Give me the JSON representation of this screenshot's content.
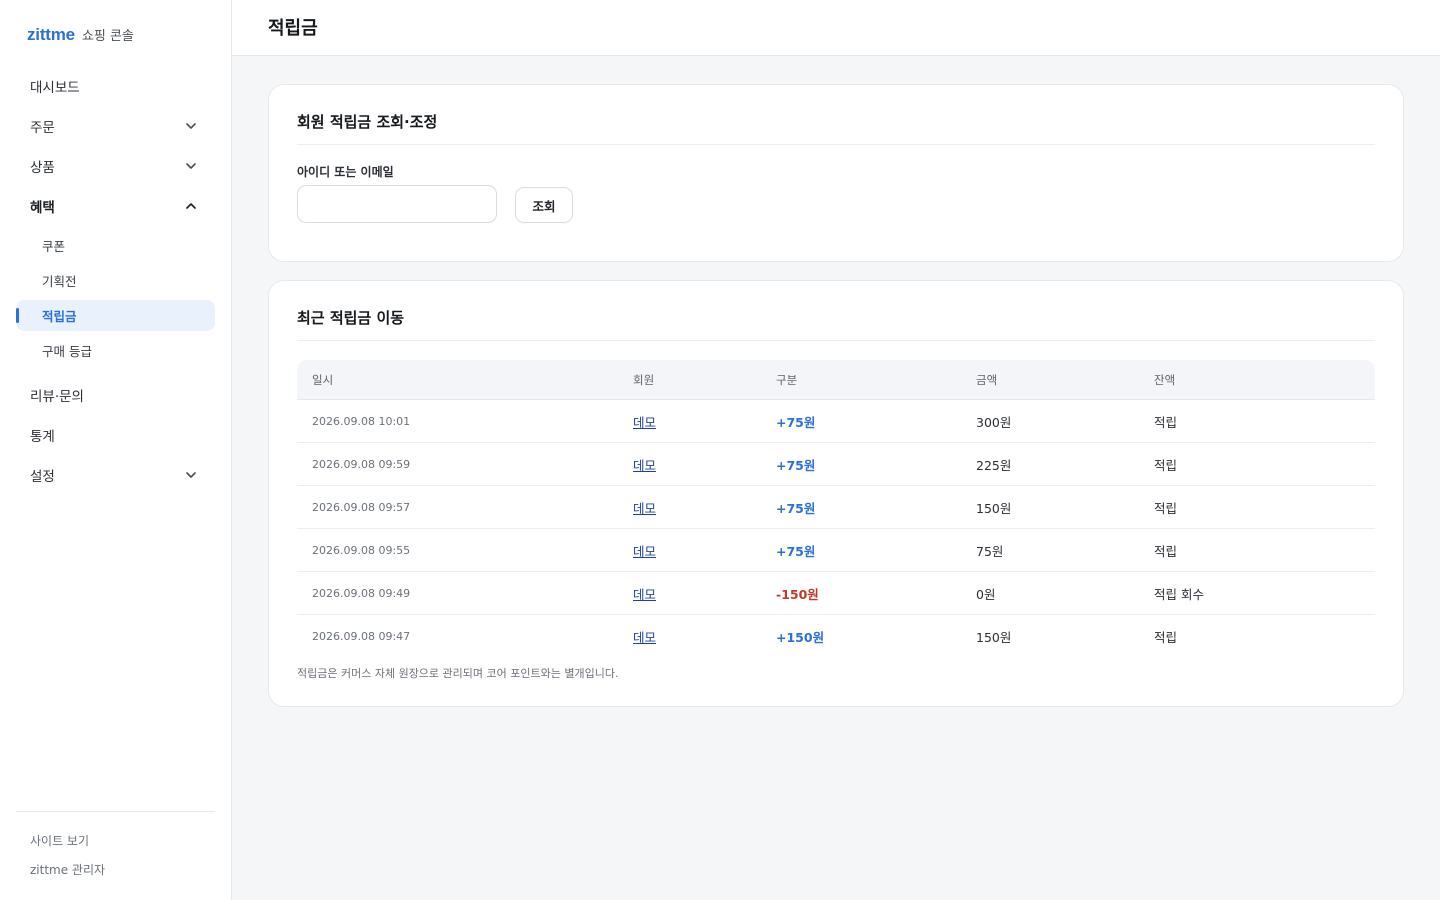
{
  "brand": {
    "name": "zittme",
    "sub": "쇼핑 콘솔"
  },
  "nav": {
    "dashboard": "대시보드",
    "orders": "주문",
    "products": "상품",
    "benefits": "혜택",
    "benefits_sub": [
      "쿠폰",
      "기획전",
      "적립금",
      "구매 등급"
    ],
    "reviews": "리뷰·문의",
    "stats": "통계",
    "settings": "설정"
  },
  "footer": {
    "view_site": "사이트 보기",
    "admin": "zittme 관리자"
  },
  "page": {
    "title": "적립금"
  },
  "lookup": {
    "title": "회원 적립금 조회·조정",
    "label": "아이디 또는 이메일",
    "value": "",
    "button": "조회"
  },
  "history": {
    "title": "최근 적립금 이동",
    "columns": [
      "일시",
      "회원",
      "구분",
      "금액",
      "잔액"
    ],
    "rows": [
      {
        "date": "2026.09.08 10:01",
        "member": "데모",
        "amount": "+75원",
        "balance": "300원",
        "type": "적립",
        "sign": "pos"
      },
      {
        "date": "2026.09.08 09:59",
        "member": "데모",
        "amount": "+75원",
        "balance": "225원",
        "type": "적립",
        "sign": "pos"
      },
      {
        "date": "2026.09.08 09:57",
        "member": "데모",
        "amount": "+75원",
        "balance": "150원",
        "type": "적립",
        "sign": "pos"
      },
      {
        "date": "2026.09.08 09:55",
        "member": "데모",
        "amount": "+75원",
        "balance": "75원",
        "type": "적립",
        "sign": "pos"
      },
      {
        "date": "2026.09.08 09:49",
        "member": "데모",
        "amount": "-150원",
        "balance": "0원",
        "type": "적립 회수",
        "sign": "neg"
      },
      {
        "date": "2026.09.08 09:47",
        "member": "데모",
        "amount": "+150원",
        "balance": "150원",
        "type": "적립",
        "sign": "pos"
      }
    ],
    "note": "적립금은 커머스 자체 원장으로 관리되며 코어 포인트와는 별개입니다."
  },
  "colors": {
    "accent": "#2a6fdb",
    "negative": "#c0392b",
    "link": "#1d3fa8"
  },
  "icons": {
    "collapsed": "chevron-down-icon",
    "expanded": "chevron-up-icon"
  }
}
